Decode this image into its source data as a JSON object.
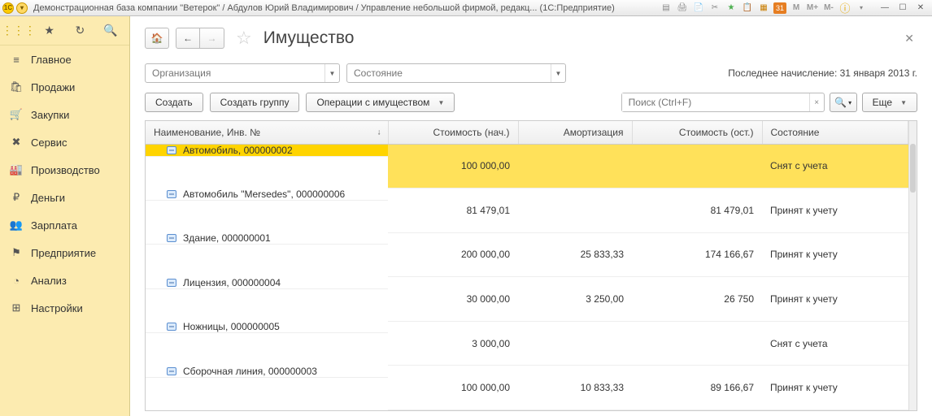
{
  "titlebar": {
    "title": "Демонстрационная база компании \"Ветерок\" / Абдулов Юрий Владимирович / Управление небольшой фирмой, редакц... (1С:Предприятие)",
    "m": "M",
    "mp": "M+",
    "mm": "M-"
  },
  "sidebar": {
    "items": [
      {
        "icon": "≡",
        "label": "Главное"
      },
      {
        "icon": "🛍",
        "label": "Продажи"
      },
      {
        "icon": "🛒",
        "label": "Закупки"
      },
      {
        "icon": "✖",
        "label": "Сервис"
      },
      {
        "icon": "🏭",
        "label": "Производство"
      },
      {
        "icon": "₽",
        "label": "Деньги"
      },
      {
        "icon": "👥",
        "label": "Зарплата"
      },
      {
        "icon": "⚑",
        "label": "Предприятие"
      },
      {
        "icon": "◔",
        "label": "Анализ"
      },
      {
        "icon": "⊞",
        "label": "Настройки"
      }
    ]
  },
  "page": {
    "title": "Имущество",
    "org_placeholder": "Организация",
    "state_placeholder": "Состояние",
    "last_accrual": "Последнее начисление: 31 января 2013 г.",
    "create": "Создать",
    "create_group": "Создать группу",
    "operations": "Операции с имуществом",
    "search_placeholder": "Поиск (Ctrl+F)",
    "more": "Еще"
  },
  "table": {
    "cols": {
      "name": "Наименование, Инв. №",
      "cost1": "Стоимость (нач.)",
      "amort": "Амортизация",
      "cost2": "Стоимость (ост.)",
      "state": "Состояние"
    },
    "rows": [
      {
        "name": "Автомобиль, 000000002",
        "cost1": "100 000,00",
        "amort": "",
        "cost2": "",
        "state": "Снят с учета",
        "sel": true
      },
      {
        "name": "Автомобиль \"Mersedes\", 000000006",
        "cost1": "81 479,01",
        "amort": "",
        "cost2": "81 479,01",
        "state": "Принят к учету"
      },
      {
        "name": "Здание, 000000001",
        "cost1": "200 000,00",
        "amort": "25 833,33",
        "cost2": "174 166,67",
        "state": "Принят к учету"
      },
      {
        "name": "Лицензия, 000000004",
        "cost1": "30 000,00",
        "amort": "3 250,00",
        "cost2": "26 750",
        "state": "Принят к учету"
      },
      {
        "name": "Ножницы, 000000005",
        "cost1": "3 000,00",
        "amort": "",
        "cost2": "",
        "state": "Снят с учета"
      },
      {
        "name": "Сборочная линия, 000000003",
        "cost1": "100 000,00",
        "amort": "10 833,33",
        "cost2": "89 166,67",
        "state": "Принят к учету"
      }
    ]
  }
}
